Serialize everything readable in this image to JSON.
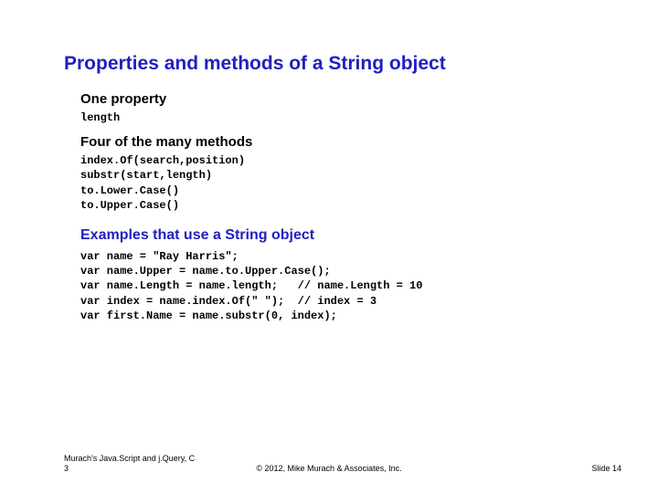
{
  "title": "Properties and methods of a String object",
  "sections": {
    "one_property": {
      "heading": "One property",
      "code": "length"
    },
    "four_methods": {
      "heading": "Four of the many methods",
      "code": "index.Of(search,position)\nsubstr(start,length)\nto.Lower.Case()\nto.Upper.Case()"
    },
    "examples": {
      "heading": "Examples that use a String object",
      "code": "var name = \"Ray Harris\";\nvar name.Upper = name.to.Upper.Case();\nvar name.Length = name.length;   // name.Length = 10\nvar index = name.index.Of(\" \");  // index = 3\nvar first.Name = name.substr(0, index);"
    }
  },
  "footer": {
    "left": "Murach's Java.Script and j.Query, C 3",
    "center": "© 2012, Mike Murach & Associates, Inc.",
    "right": "Slide 14"
  }
}
